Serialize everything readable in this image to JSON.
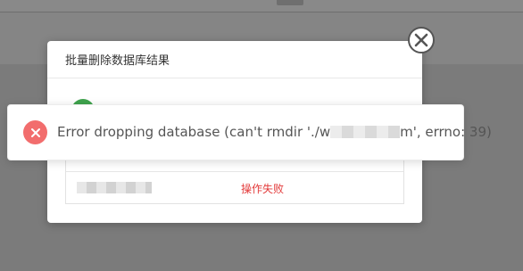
{
  "dialog": {
    "title": "批量删除数据库结果"
  },
  "table": {
    "headers": [
      "",
      ""
    ],
    "rows": [
      {
        "status": "操作失败"
      }
    ]
  },
  "toast": {
    "message_before": "Error dropping database (can't rmdir './w",
    "message_after": "m', errno: 39)"
  },
  "icons": {
    "dialog_close": "close-circle-icon",
    "toast": "error-x-icon",
    "success": "success-check-icon"
  },
  "colors": {
    "error": "#f26d6d",
    "status_fail": "#e33b3b",
    "success": "#3fa34d"
  }
}
